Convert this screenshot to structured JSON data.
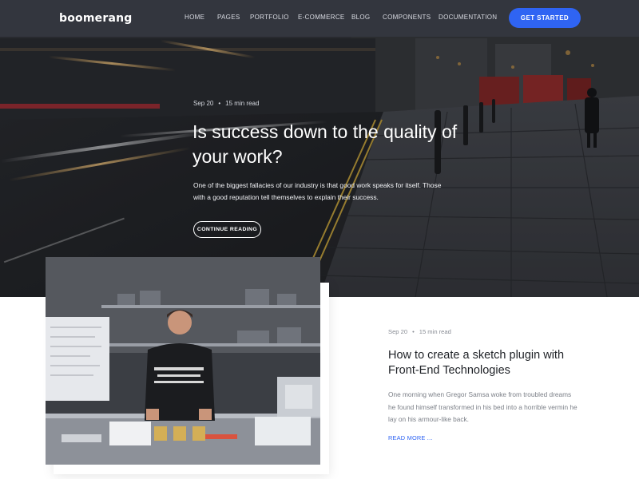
{
  "brand": {
    "logo_text": "boomerang"
  },
  "nav": {
    "items": [
      {
        "label": "HOME"
      },
      {
        "label": "PAGES"
      },
      {
        "label": "PORTFOLIO"
      },
      {
        "label": "E-COMMERCE"
      },
      {
        "label": "BLOG"
      },
      {
        "label": "COMPONENTS"
      },
      {
        "label": "DOCUMENTATION"
      }
    ],
    "cta_label": "GET STARTED"
  },
  "hero": {
    "date": "Sep 20",
    "read_time": "15 min read",
    "title": "Is success down to the quality of your work?",
    "excerpt": "One of the biggest fallacies of our industry is that good work speaks for itself. Those with a good reputation tell themselves to explain their success.",
    "button_label": "CONTINUE READING"
  },
  "post": {
    "date": "Sep 20",
    "read_time": "15 min read",
    "title": "How to create a sketch plugin with Front-End Technologies",
    "excerpt": "One morning when Gregor Samsa woke from troubled dreams he found himself transformed in his bed into a horrible vermin he lay on his armour-like back.",
    "link_label": "READ MORE ...",
    "image_shirt_text": "COPS & ROBBERS SMASH COWBOYS & INJUNS"
  },
  "colors": {
    "nav_bg": "#34373e",
    "accent": "#2f64f3",
    "title_dark": "#1e2126",
    "body_gray": "#7b7f87"
  }
}
